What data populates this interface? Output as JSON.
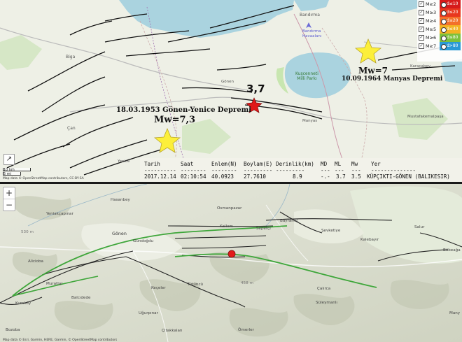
{
  "top_map": {
    "places": {
      "bandirma": "Bandırma",
      "bandirma_airport": "Bandırma\nHavaalanı",
      "biga": "Biga",
      "can": "Çan",
      "gonen": "Gönen",
      "manyas": "Manyas",
      "kus_park": "Kuşcenneti\nMilli Parkı",
      "karacabey": "Karacabey",
      "mustafakemalpasa": "Mustafakemalpaşa",
      "yenice": "Yenice"
    },
    "events": {
      "gonen_1953_title": "18.03.1953 Gönen-Yenice Depremi",
      "gonen_1953_mw": "Mw=7,3",
      "manyas_1964_mw": "Mw=7",
      "manyas_1964_title": "10.09.1964 Manyas Depremi",
      "current_mag": "3,7"
    },
    "legend": [
      {
        "mag": "M≥2",
        "depth": "d≤10",
        "color": "#d61b1b"
      },
      {
        "mag": "M≥3",
        "depth": "d≤20",
        "color": "#e8371e"
      },
      {
        "mag": "M≥4",
        "depth": "d≤20",
        "color": "#f3702a"
      },
      {
        "mag": "M≥5",
        "depth": "d≤40",
        "color": "#f2b323"
      },
      {
        "mag": "M≥6",
        "depth": "d≤80",
        "color": "#7cc13c"
      },
      {
        "mag": "M≥7",
        "depth": "d>80",
        "color": "#2a9ad6"
      }
    ],
    "scale": {
      "km": "10 km",
      "mi": "5 mi"
    },
    "fullscreen_icon": "expand-arrow",
    "attribution": "Map data © OpenStreetMap contributors, CC-BY-SA"
  },
  "info_table": {
    "headers": [
      "Tarih",
      "Saat",
      "Enlem(N)",
      "Boylam(E)",
      "Derinlik(km)",
      "MD",
      "ML",
      "Mw",
      "Yer"
    ],
    "separators": [
      "----------",
      "--------",
      "--------",
      "---------",
      "---------",
      "---",
      "---",
      "---",
      "--------------"
    ],
    "row": [
      "2017.12.14",
      "02:10:54",
      "40.0923",
      "27.7610",
      "8.9",
      "-.-",
      "3.7",
      "3.5",
      "KÜPÇIKTI-GÖNEN (BALIKESIR)"
    ]
  },
  "bottom_map": {
    "places": {
      "hasanbey": "Hasanbey",
      "osmanpazar": "Osmanpazar",
      "yeniakcapinar": "Yeniakçapınar",
      "gonen": "Gönen",
      "kalkim": "Kalkım",
      "bayramic": "Bayramiç",
      "sepetci": "Sepetçi",
      "gundogdu": "Gündoğdu",
      "sevketiye": "Şevketiye",
      "salur": "Salur",
      "kalebayir": "Kalebayır",
      "bobeaga": "Böbeağa",
      "alicioba": "Alicioba",
      "muratlar": "Muratlar",
      "kecelar": "Keçeler",
      "tutuncu": "Tütüncü",
      "calirca": "Çalırca",
      "kumkoy": "Kumköy",
      "balcidede": "Balcıdede",
      "ugurpinar": "Uğurpınar",
      "suleymanli": "Süleymanlı",
      "bozoba": "Bozoba",
      "citakkalan": "Çitakkalan",
      "omerler": "Ömerler",
      "many": "Many",
      "elev_530": "530 m",
      "elev_458": "458 m"
    },
    "zoom": {
      "in": "+",
      "out": "−"
    },
    "attribution": "Map data © Esri, Garmin, HERE, Garmin, © OpenStreetMap contributors"
  },
  "top_zoom": {
    "in": "+",
    "out": "−"
  }
}
